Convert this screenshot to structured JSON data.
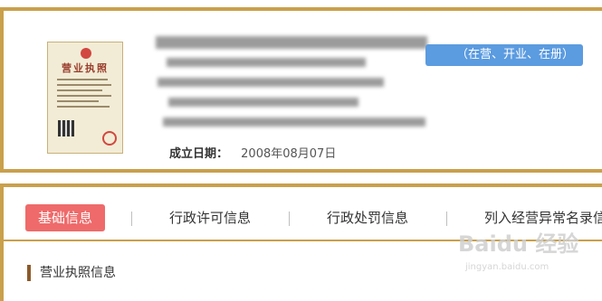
{
  "company": {
    "status_label": "（在营、开业、在册）",
    "founded_label": "成立日期：",
    "founded_value": "2008年08月07日"
  },
  "license_image": {
    "title": "营业执照"
  },
  "tabs": [
    {
      "label": "基础信息",
      "active": true
    },
    {
      "label": "行政许可信息",
      "active": false
    },
    {
      "label": "行政处罚信息",
      "active": false
    },
    {
      "label": "列入经营异常名录信息",
      "active": false
    }
  ],
  "section_title": "营业执照信息",
  "watermark": {
    "text": "Baidu 经验",
    "sub": "jingyan.baidu.com"
  },
  "colors": {
    "border_gold": "#c9a04c",
    "status_blue": "#5b9be0",
    "active_tab": "#ef6a6a",
    "section_marker": "#8b5a2b"
  }
}
